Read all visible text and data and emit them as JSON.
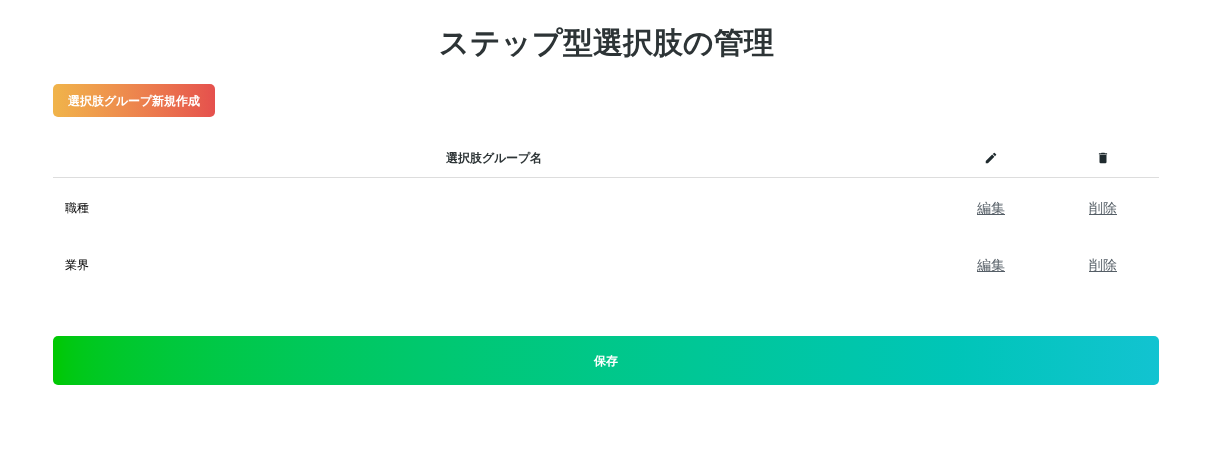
{
  "title": "ステップ型選択肢の管理",
  "create_button": "選択肢グループ新規作成",
  "table": {
    "columns": [
      {
        "kind": "text",
        "label": "選択肢グループ名"
      },
      {
        "kind": "edit"
      },
      {
        "kind": "delete"
      }
    ],
    "rows": [
      {
        "name": "職種",
        "edit": "編集",
        "delete": "削除"
      },
      {
        "name": "業界",
        "edit": "編集",
        "delete": "削除"
      }
    ]
  },
  "save_button": "保存"
}
